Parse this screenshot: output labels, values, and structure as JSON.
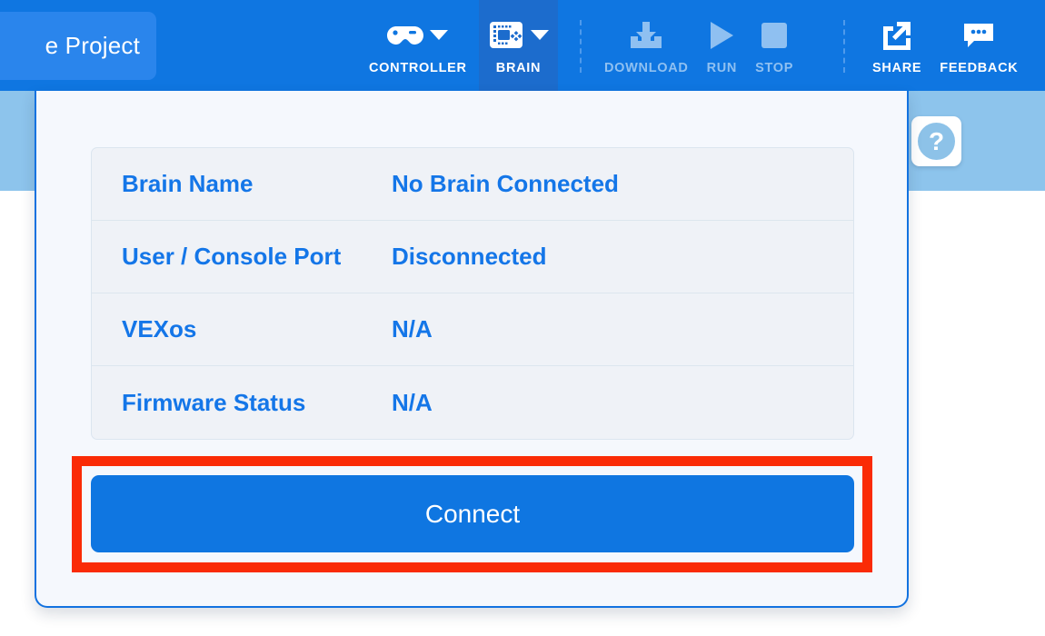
{
  "window": {
    "project_tab_label": "e Project",
    "toolbar_color": "#0f76e1",
    "tab_color": "#2a85ec",
    "accent_color": "#1476e8",
    "highlight_color": "#fa2b06"
  },
  "toolbar": {
    "items": [
      {
        "label": "CONTROLLER",
        "icon": "gamepad-icon",
        "has_caret": true,
        "state": "enabled"
      },
      {
        "label": "BRAIN",
        "icon": "brain-device-icon",
        "has_caret": true,
        "state": "active"
      },
      {
        "label": "DOWNLOAD",
        "icon": "download-icon",
        "has_caret": false,
        "state": "disabled"
      },
      {
        "label": "RUN",
        "icon": "play-icon",
        "has_caret": false,
        "state": "disabled"
      },
      {
        "label": "STOP",
        "icon": "stop-icon",
        "has_caret": false,
        "state": "disabled"
      },
      {
        "label": "SHARE",
        "icon": "share-icon",
        "has_caret": false,
        "state": "enabled"
      },
      {
        "label": "FEEDBACK",
        "icon": "comment-icon",
        "has_caret": false,
        "state": "enabled"
      }
    ]
  },
  "brain_dialog": {
    "rows": [
      {
        "label": "Brain Name",
        "value": "No Brain Connected"
      },
      {
        "label": "User / Console Port",
        "value": "Disconnected"
      },
      {
        "label": "VEXos",
        "value": "N/A"
      },
      {
        "label": "Firmware Status",
        "value": "N/A"
      }
    ],
    "connect_button_label": "Connect"
  },
  "help": {
    "glyph": "?"
  }
}
